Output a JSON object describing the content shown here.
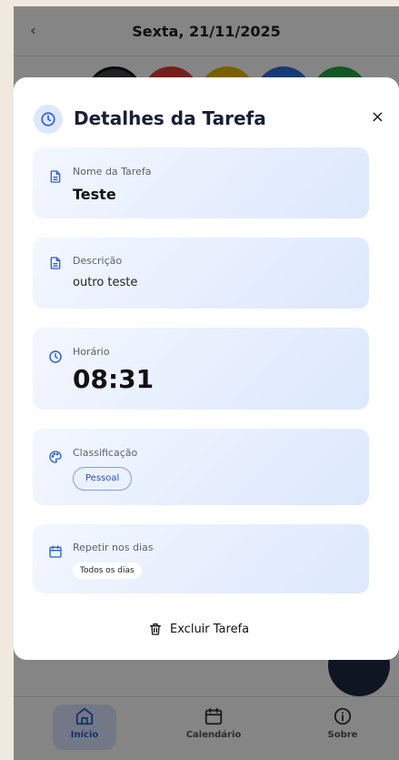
{
  "header": {
    "prev_glyph": "‹",
    "next_glyph": "›",
    "date": "Sexta, 21/11/2025"
  },
  "swatches": [
    "#3b3f45",
    "#e03b3b",
    "#e6b800",
    "#2f6fe0",
    "#28a745"
  ],
  "fab_color": "#1f2a44",
  "accent": "#2b5fd9",
  "modal": {
    "title": "Detalhes da Tarefa",
    "close_glyph": "×",
    "name": {
      "label": "Nome da Tarefa",
      "value": "Teste"
    },
    "description": {
      "label": "Descrição",
      "value": "outro teste"
    },
    "time": {
      "label": "Horário",
      "value": "08:31"
    },
    "classification": {
      "label": "Classificação",
      "value": "Pessoal"
    },
    "repeat": {
      "label": "Repetir nos dias",
      "value": "Todos os dias"
    },
    "delete_label": "Excluir Tarefa"
  },
  "bottom_nav": {
    "items": [
      {
        "label": "Início",
        "icon": "home-icon",
        "active": true
      },
      {
        "label": "Calendário",
        "icon": "calendar-icon",
        "active": false
      },
      {
        "label": "Sobre",
        "icon": "info-icon",
        "active": false
      }
    ]
  }
}
